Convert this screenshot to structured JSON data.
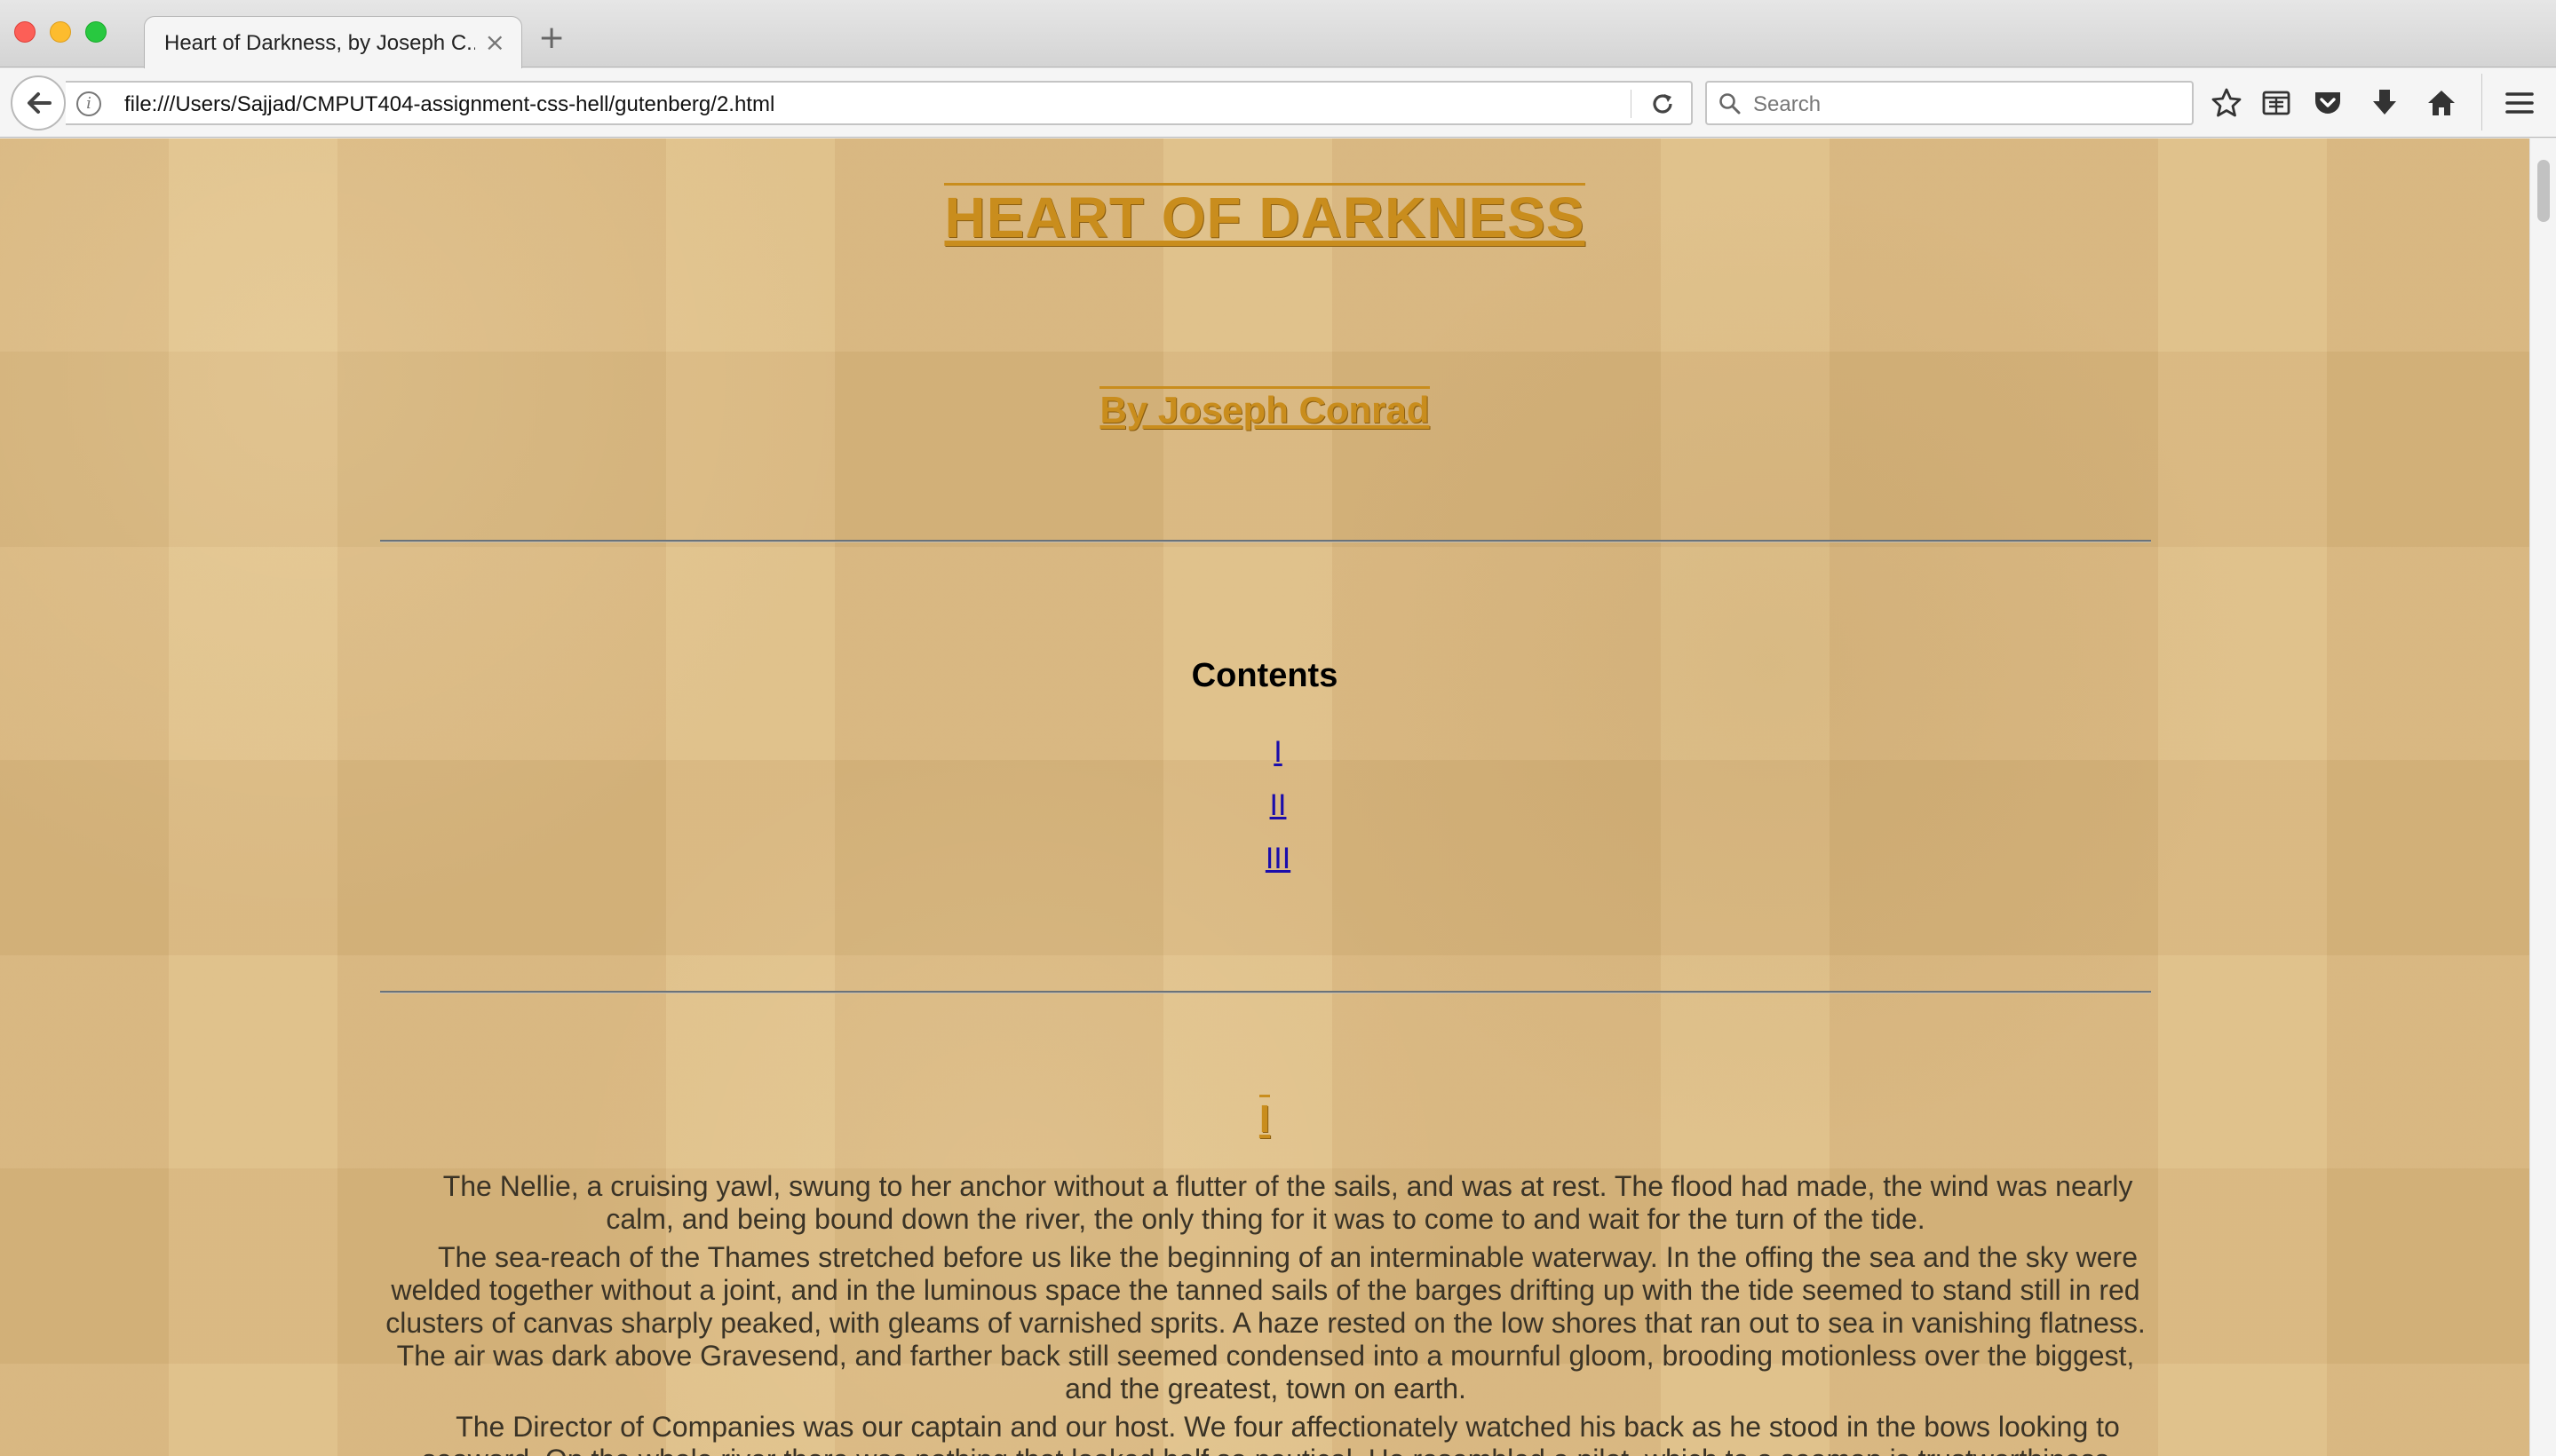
{
  "browser": {
    "tab_title": "Heart of Darkness, by Joseph C...",
    "tab_close_glyph": "×",
    "new_tab_glyph": "+",
    "url": "file:///Users/Sajjad/CMPUT404-assignment-css-hell/gutenberg/2.html",
    "info_glyph": "i",
    "search_placeholder": "Search",
    "icons": [
      "back-arrow-icon",
      "info-icon",
      "reload-icon",
      "search-icon",
      "bookmark-star-icon",
      "reader-view-icon",
      "pocket-icon",
      "download-icon",
      "home-icon",
      "hamburger-menu-icon"
    ]
  },
  "page": {
    "title": "HEART OF DARKNESS",
    "author": "By Joseph Conrad",
    "contents_heading": "Contents",
    "toc": [
      "I",
      "II",
      "III"
    ],
    "chapter_heading": "I",
    "paragraphs": [
      "The Nellie, a cruising yawl, swung to her anchor without a flutter of the sails, and was at rest. The flood had made, the wind was nearly calm, and being bound down the river, the only thing for it was to come to and wait for the turn of the tide.",
      "The sea-reach of the Thames stretched before us like the beginning of an interminable waterway. In the offing the sea and the sky were welded together without a joint, and in the luminous space the tanned sails of the barges drifting up with the tide seemed to stand still in red clusters of canvas sharply peaked, with gleams of varnished sprits. A haze rested on the low shores that ran out to sea in vanishing flatness. The air was dark above Gravesend, and farther back still seemed condensed into a mournful gloom, brooding motionless over the biggest, and the greatest, town on earth.",
      "The Director of Companies was our captain and our host. We four affectionately watched his back as he stood in the bows looking to seaward. On the whole river there was nothing that looked half so nautical. He resembled a pilot, which to a seaman is trustworthiness personified."
    ]
  },
  "colors": {
    "heading_gold": "#c98d1d",
    "link_blue": "#1a0dab",
    "paper_tan": "#dcba82",
    "body_text": "#3a3326"
  }
}
